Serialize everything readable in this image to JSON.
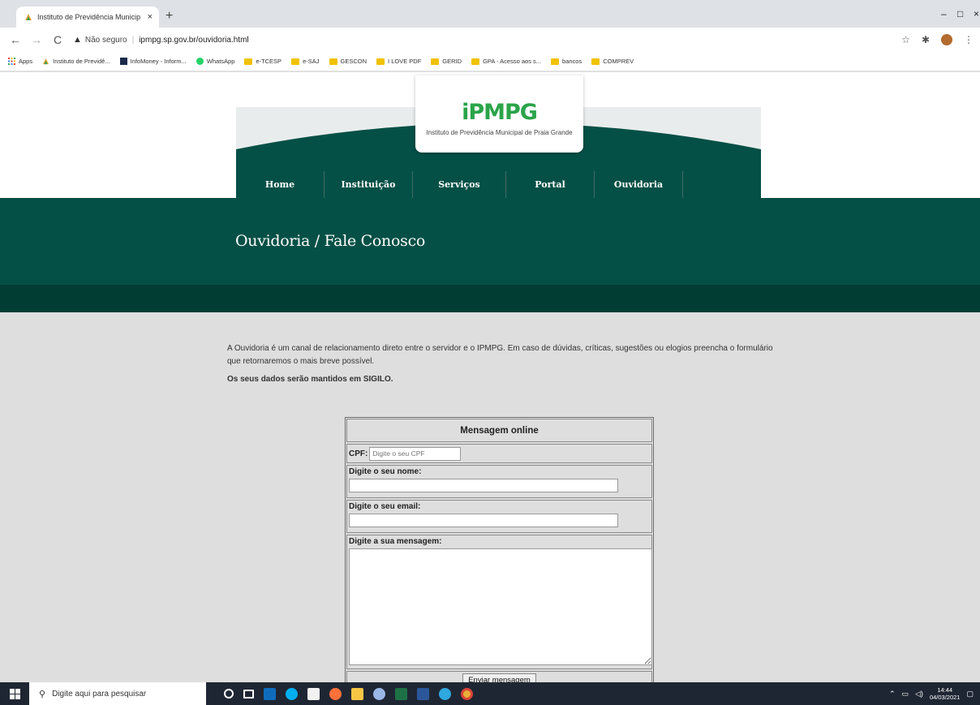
{
  "browser": {
    "tab_title": "Instituto de Previdência Municip",
    "tab_close": "×",
    "new_tab": "+",
    "security_label": "Não seguro",
    "url": "ipmpg.sp.gov.br/ouvidoria.html",
    "window_controls": [
      "–",
      "□",
      "×"
    ],
    "bookmarks": [
      {
        "label": "Apps",
        "icon": "apps-grid-icon"
      },
      {
        "label": "Instituto de Previdê...",
        "icon": "ipmpg-favicon"
      },
      {
        "label": "InfoMoney - Inform...",
        "icon": "infomoney-icon"
      },
      {
        "label": "WhatsApp",
        "icon": "whatsapp-icon"
      },
      {
        "label": "e-TCESP",
        "icon": "folder-icon"
      },
      {
        "label": "e-SAJ",
        "icon": "folder-icon"
      },
      {
        "label": "GESCON",
        "icon": "folder-icon"
      },
      {
        "label": "I LOVE PDF",
        "icon": "folder-icon"
      },
      {
        "label": "GERID",
        "icon": "folder-icon"
      },
      {
        "label": "GPA - Acesso aos s...",
        "icon": "folder-icon"
      },
      {
        "label": "bancos",
        "icon": "folder-icon"
      },
      {
        "label": "COMPREV",
        "icon": "folder-icon"
      }
    ]
  },
  "site": {
    "logo_text": "iPMPG",
    "logo_subtitle": "Instituto de Previdência Municipal de Praia Grande",
    "nav": [
      "Home",
      "Instituição",
      "Serviços",
      "Portal",
      "Ouvidoria"
    ],
    "page_title": "Ouvidoria / Fale Conosco",
    "intro": "A Ouvidoria é um canal de relacionamento direto entre o servidor e o IPMPG. Em caso de dúvidas, críticas, sugestões ou elogios preencha o formulário que retornaremos o mais breve possível.",
    "privacy": "Os seus dados serão mantidos em SIGILO."
  },
  "form": {
    "title": "Mensagem online",
    "cpf_label": "CPF:",
    "cpf_placeholder": "Digite o seu CPF",
    "name_label": "Digite o seu nome:",
    "email_label": "Digite o seu email:",
    "message_label": "Digite a sua mensagem:",
    "submit_label": "Enviar mensagem"
  },
  "taskbar": {
    "search_placeholder": "Digite aqui para pesquisar",
    "time": "14:44",
    "date": "04/03/2021"
  },
  "colors": {
    "brand_green": "#2aa449",
    "dark_teal": "#055046",
    "darker_teal": "#023d34"
  }
}
